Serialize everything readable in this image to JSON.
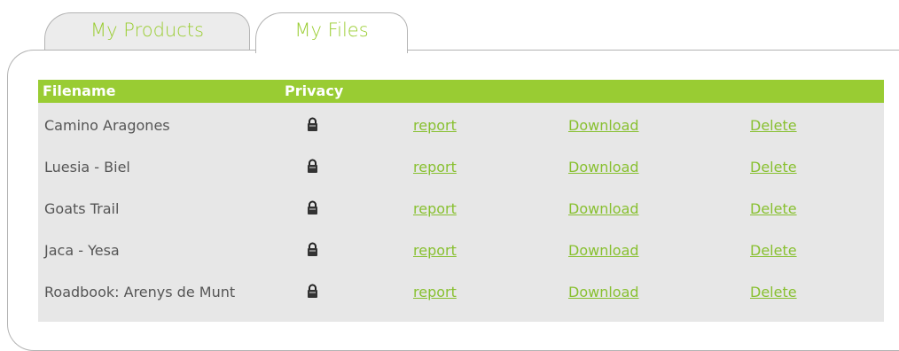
{
  "tabs": [
    {
      "label": "My Products",
      "active": false
    },
    {
      "label": "My Files",
      "active": true
    }
  ],
  "table": {
    "headers": {
      "filename": "Filename",
      "privacy": "Privacy"
    },
    "rows": [
      {
        "filename": "Camino Aragones",
        "privacy_icon": "lock-icon",
        "report": "report",
        "download": "Download",
        "delete": "Delete"
      },
      {
        "filename": "Luesia - Biel",
        "privacy_icon": "lock-icon",
        "report": "report",
        "download": "Download",
        "delete": "Delete"
      },
      {
        "filename": "Goats Trail",
        "privacy_icon": "lock-icon",
        "report": "report",
        "download": "Download",
        "delete": "Delete"
      },
      {
        "filename": "Jaca - Yesa",
        "privacy_icon": "lock-icon",
        "report": "report",
        "download": "Download",
        "delete": "Delete"
      },
      {
        "filename": "Roadbook: Arenys de Munt",
        "privacy_icon": "lock-icon",
        "report": "report",
        "download": "Download",
        "delete": "Delete"
      }
    ]
  },
  "colors": {
    "accent": "#99cc33",
    "link": "#88c030",
    "table_bg": "#e7e7e7",
    "text": "#555555"
  }
}
